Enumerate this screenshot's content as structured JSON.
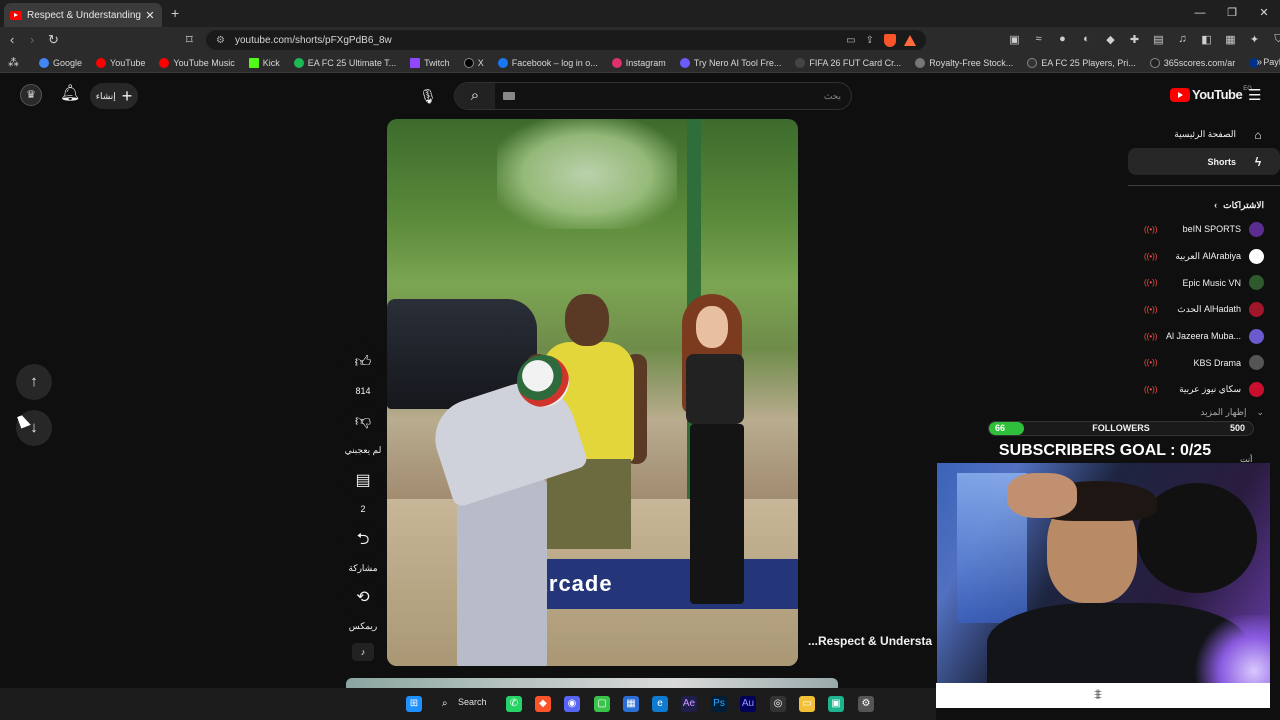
{
  "browser": {
    "tab_title": "Respect & Understanding 💛",
    "new_tab": "+",
    "url": "youtube.com/shorts/pFXgPdB6_8w"
  },
  "bookmarks": [
    {
      "label": "Google",
      "color": "#4285f4"
    },
    {
      "label": "YouTube",
      "color": "#ff0000"
    },
    {
      "label": "YouTube Music",
      "color": "#ff0000"
    },
    {
      "label": "Kick",
      "color": "#53fc18"
    },
    {
      "label": "EA FC 25 Ultimate T...",
      "color": "#1db954"
    },
    {
      "label": "Twitch",
      "color": "#9146ff"
    },
    {
      "label": "X",
      "color": "#000000"
    },
    {
      "label": "Facebook – log in o...",
      "color": "#1877f2"
    },
    {
      "label": "Instagram",
      "color": "#e1306c"
    },
    {
      "label": "Try Nero AI Tool Fre...",
      "color": "#6b5bff"
    },
    {
      "label": "FIFA 26 FUT Card Cr...",
      "color": "#444444"
    },
    {
      "label": "Royalty-Free Stock...",
      "color": "#777777"
    },
    {
      "label": "EA FC 25 Players, Pri...",
      "color": "#333333"
    },
    {
      "label": "365scores.com/ar",
      "color": "#222222"
    },
    {
      "label": "PayPal: الموجز",
      "color": "#003087"
    }
  ],
  "header": {
    "create_label": "إنشاء",
    "search_placeholder": "بحث",
    "logo_text": "YouTube",
    "country_code": "EG"
  },
  "actions": {
    "like_count": "814",
    "dislike_label": "لم يعجبني",
    "comments_count": "2",
    "share_label": "مشاركة",
    "remix_label": "ريمكس"
  },
  "video": {
    "title": "...Respect & Understa",
    "sign_text": "Arcade"
  },
  "sidebar": {
    "home": "الصفحة الرئيسية",
    "shorts": "Shorts",
    "subscriptions_header": "الاشتراكات",
    "subscriptions": [
      {
        "name": "beIN SPORTS",
        "color": "#5b2d90"
      },
      {
        "name": "العربية AlArabiya",
        "color": "#ffffff"
      },
      {
        "name": "Epic Music VN",
        "color": "#2e5a2e"
      },
      {
        "name": "الحدث AlHadath",
        "color": "#a0162a"
      },
      {
        "name": "Al Jazeera Muba...",
        "color": "#6a5acd"
      },
      {
        "name": "KBS Drama",
        "color": "#555555"
      },
      {
        "name": "سكاي نيوز عربية",
        "color": "#c8102e"
      }
    ],
    "show_more": "إظهار المزيد",
    "you_label": "أنت"
  },
  "overlay": {
    "followers_current": "66",
    "followers_label": "FOLLOWERS",
    "followers_max": "500",
    "followers_progress": 0.132,
    "goal_text": "SUBSCRIBERS GOAL : 0/25"
  },
  "taskbar": {
    "search_label": "Search"
  }
}
